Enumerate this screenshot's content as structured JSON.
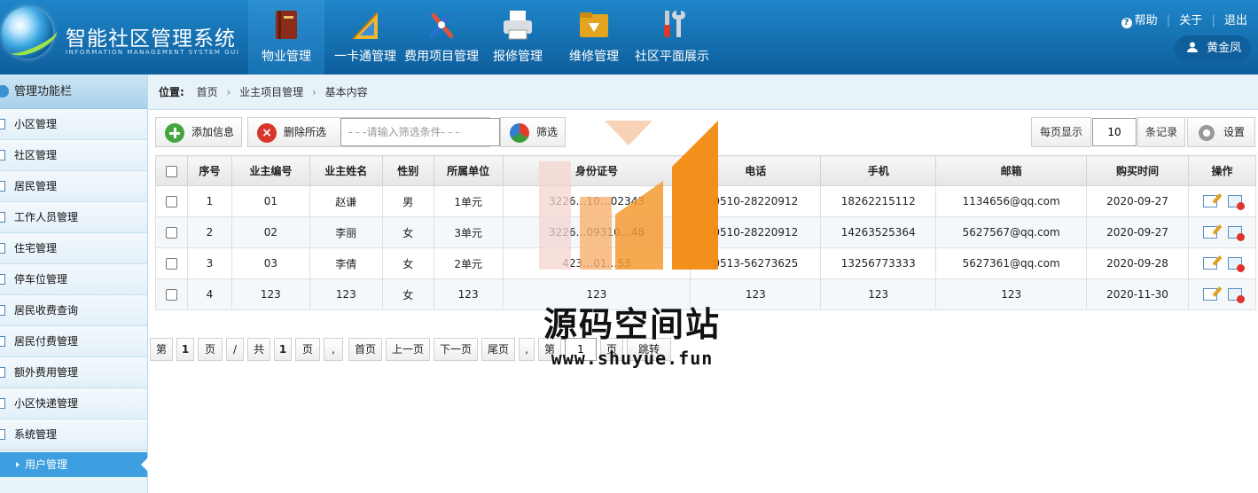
{
  "header": {
    "title": "智能社区管理系统",
    "subtitle": "INFORMATION MANAGEMENT SYSTEM GUI",
    "nav": [
      {
        "label": "物业管理",
        "icon": "book-icon",
        "active": true
      },
      {
        "label": "一卡通管理",
        "icon": "ruler-icon",
        "active": false
      },
      {
        "label": "费用项目管理",
        "icon": "tools-icon",
        "active": false
      },
      {
        "label": "报修管理",
        "icon": "printer-icon",
        "active": false
      },
      {
        "label": "维修管理",
        "icon": "folder-download-icon",
        "active": false
      },
      {
        "label": "社区平面展示",
        "icon": "wrench-screwdriver-icon",
        "active": false
      }
    ],
    "links": {
      "help": "帮助",
      "about": "关于",
      "logout": "退出"
    },
    "user": "黄金凤"
  },
  "sidebar": {
    "title": "管理功能栏",
    "items": [
      "小区管理",
      "社区管理",
      "居民管理",
      "工作人员管理",
      "住宅管理",
      "停车位管理",
      "居民收费查询",
      "居民付费管理",
      "额外费用管理",
      "小区快递管理",
      "系统管理"
    ],
    "sub_active": "用户管理"
  },
  "breadcrumb": {
    "label": "位置:",
    "items": [
      "首页",
      "业主项目管理",
      "基本内容"
    ]
  },
  "toolbar": {
    "add": "添加信息",
    "delete": "删除所选",
    "filter_placeholder": "- - -请输入筛选条件- - -",
    "filter": "筛选",
    "per_page_label": "每页显示",
    "per_page_value": "10",
    "per_page_unit": "条记录",
    "settings": "设置"
  },
  "table": {
    "columns": [
      "序号",
      "业主编号",
      "业主姓名",
      "性别",
      "所属单位",
      "身份证号",
      "电话",
      "手机",
      "邮箱",
      "购买时间",
      "操作"
    ],
    "rows": [
      [
        "1",
        "01",
        "赵谦",
        "男",
        "1单元",
        "3226…10…02343",
        "0510-28220912",
        "18262215112",
        "1134656@qq.com",
        "2020-09-27"
      ],
      [
        "2",
        "02",
        "李丽",
        "女",
        "3单元",
        "3226…09310…48",
        "0510-28220912",
        "14263525364",
        "5627567@qq.com",
        "2020-09-27"
      ],
      [
        "3",
        "03",
        "李倩",
        "女",
        "2单元",
        "423…01…53",
        "0513-56273625",
        "13256773333",
        "5627361@qq.com",
        "2020-09-28"
      ],
      [
        "4",
        "123",
        "123",
        "女",
        "123",
        "123",
        "123",
        "123",
        "123",
        "2020-11-30"
      ]
    ]
  },
  "pager": {
    "di": "第",
    "page": "1",
    "ye": "页",
    "slash": "/",
    "gong": "共",
    "total": "1",
    "ye2": "页",
    "comma": ",",
    "first": "首页",
    "prev": "上一页",
    "next": "下一页",
    "last": "尾页",
    "comma2": ",",
    "di2": "第",
    "jump_value": "1",
    "ye3": "页",
    "jump": "跳转"
  },
  "watermark": {
    "text": "源码空间站",
    "url": "www.shuyue.fun"
  },
  "colors": {
    "header": "#1570b2",
    "sidebar_active": "#3d9fe0",
    "watermark_orange": "#f39a2c"
  }
}
